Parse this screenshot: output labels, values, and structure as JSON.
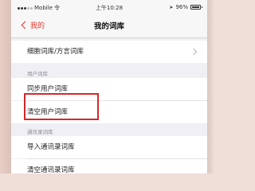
{
  "status_bar": {
    "carrier": "Mobile",
    "network": "令",
    "time": "上午10:28",
    "battery_text": "96%",
    "battery_level": 0.96
  },
  "nav": {
    "back_label": "我的",
    "title": "我的词库"
  },
  "rows": {
    "cell_dict": "细胞词库/方言词库",
    "user_section": "用户词库",
    "sync_user": "同步用户词库",
    "clear_user": "清空用户词库",
    "contacts_section": "通讯录词库",
    "import_contacts": "导入通讯录词库",
    "clear_contacts": "清空通讯录词库"
  },
  "colors": {
    "accent": "#e5362f",
    "highlight_box": "#d42a2a",
    "background": "#efeff4"
  }
}
